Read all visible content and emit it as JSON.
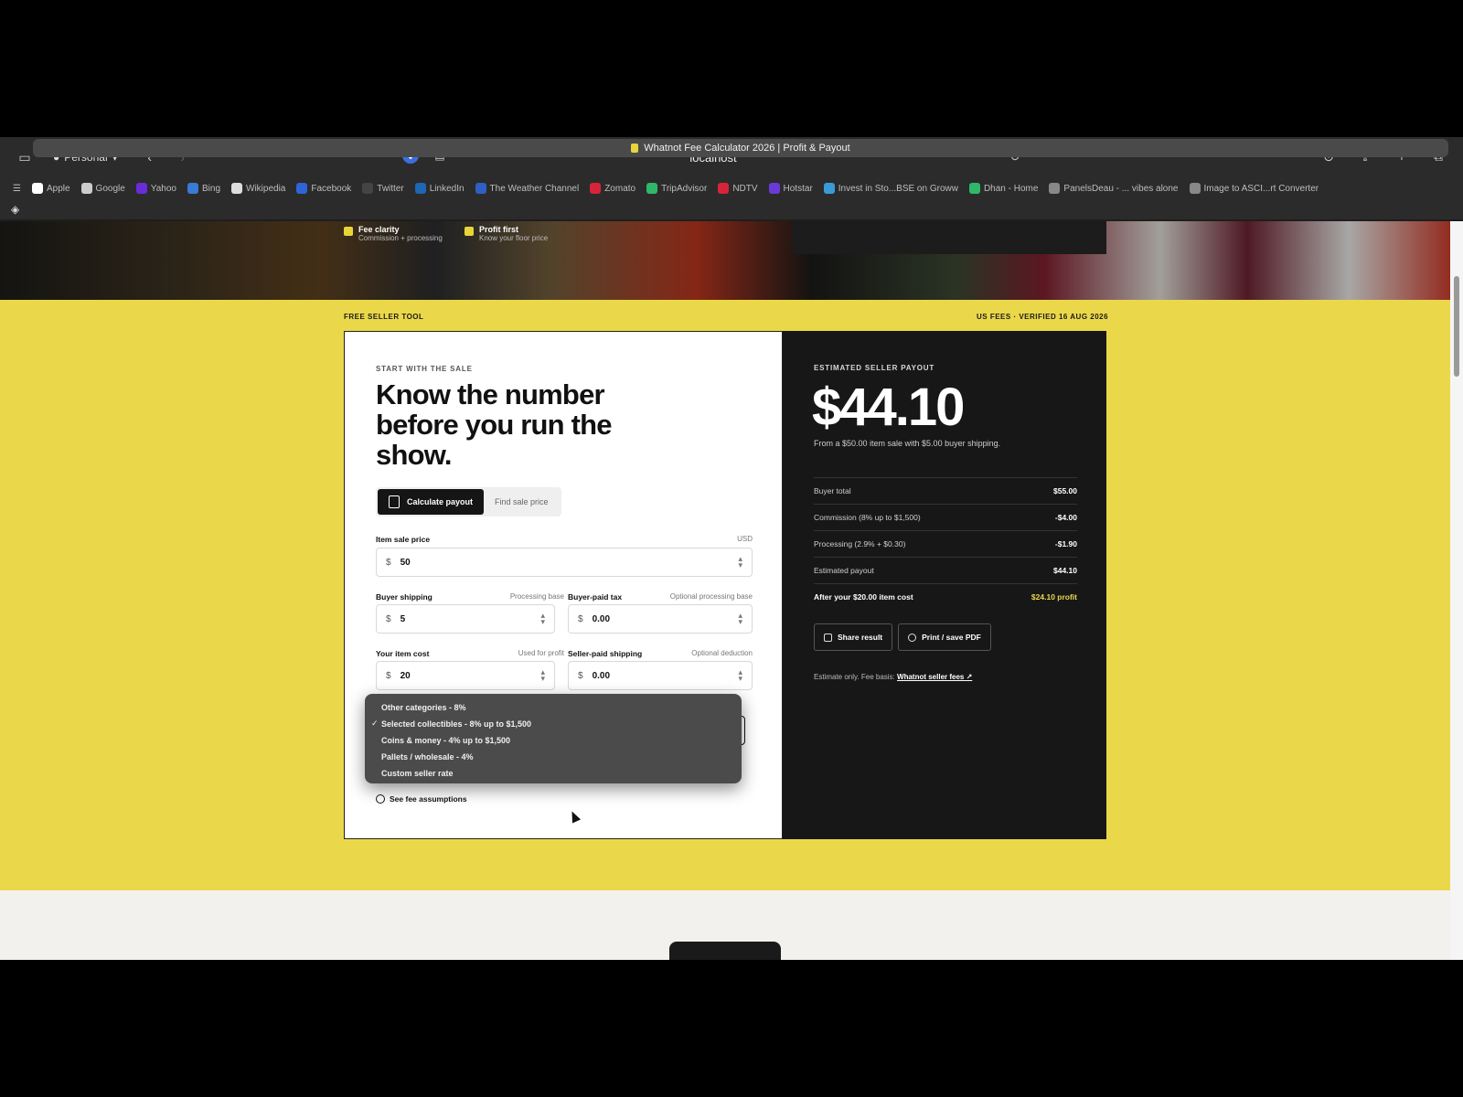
{
  "browser": {
    "profile": "Personal",
    "url": "localhost",
    "tab_title": "Whatnot Fee Calculator 2026 | Profit & Payout",
    "bookmarks": [
      {
        "label": "Apple",
        "color": "#ffffff"
      },
      {
        "label": "Google",
        "color": "#cccccc"
      },
      {
        "label": "Yahoo",
        "color": "#6a2bd8"
      },
      {
        "label": "Bing",
        "color": "#3a7bd5"
      },
      {
        "label": "Wikipedia",
        "color": "#dddddd"
      },
      {
        "label": "Facebook",
        "color": "#2d64d8"
      },
      {
        "label": "Twitter",
        "color": "#444444"
      },
      {
        "label": "LinkedIn",
        "color": "#1d66b4"
      },
      {
        "label": "The Weather Channel",
        "color": "#2f5fc4"
      },
      {
        "label": "Zomato",
        "color": "#d8243a"
      },
      {
        "label": "TripAdvisor",
        "color": "#2fb86a"
      },
      {
        "label": "NDTV",
        "color": "#d8243a"
      },
      {
        "label": "Hotstar",
        "color": "#6a3ad8"
      },
      {
        "label": "Invest in Sto...BSE on Groww",
        "color": "#3a9ad8"
      },
      {
        "label": "Dhan - Home",
        "color": "#2fb86a"
      },
      {
        "label": "PanelsDeau - ... vibes alone",
        "color": "#888888"
      },
      {
        "label": "Image to ASCI...rt Converter",
        "color": "#888888"
      }
    ]
  },
  "hero": {
    "badges": [
      {
        "title": "Fee clarity",
        "sub": "Commission + processing"
      },
      {
        "title": "Profit first",
        "sub": "Know your floor price"
      }
    ]
  },
  "section": {
    "eyebrow_left": "FREE SELLER TOOL",
    "eyebrow_right": "US FEES · VERIFIED 16 AUG 2026"
  },
  "calculator": {
    "kicker": "START WITH THE SALE",
    "headline": "Know the number before you run the show.",
    "mode_tabs": {
      "active": "Calculate payout",
      "inactive": "Find sale price"
    },
    "fields": {
      "item_price": {
        "label": "Item sale price",
        "hint": "USD",
        "currency": "$",
        "value": "50"
      },
      "buyer_shipping": {
        "label": "Buyer shipping",
        "hint": "Processing base",
        "currency": "$",
        "value": "5"
      },
      "buyer_tax": {
        "label": "Buyer-paid tax",
        "hint": "Optional processing base",
        "currency": "$",
        "value": "0.00"
      },
      "item_cost": {
        "label": "Your item cost",
        "hint": "Used for profit",
        "currency": "$",
        "value": "20"
      },
      "seller_shipping": {
        "label": "Seller-paid shipping",
        "hint": "Optional deduction",
        "currency": "$",
        "value": "0.00"
      }
    },
    "category_options": [
      {
        "label": "Other categories - 8%",
        "selected": false
      },
      {
        "label": "Selected collectibles - 8% up to $1,500",
        "selected": true
      },
      {
        "label": "Coins & money - 4% up to $1,500",
        "selected": false
      },
      {
        "label": "Pallets / wholesale - 4%",
        "selected": false
      },
      {
        "label": "Custom seller rate",
        "selected": false
      }
    ],
    "check_glyph": "✓",
    "assumptions_link": "See fee assumptions"
  },
  "result": {
    "kicker": "ESTIMATED SELLER PAYOUT",
    "amount": "$44.10",
    "sub": "From a $50.00 item sale with $5.00 buyer shipping.",
    "rows": [
      {
        "label": "Buyer total",
        "value": "$55.00"
      },
      {
        "label": "Commission (8% up to $1,500)",
        "value": "-$4.00"
      },
      {
        "label": "Processing (2.9% + $0.30)",
        "value": "-$1.90"
      },
      {
        "label": "Estimated payout",
        "value": "$44.10"
      },
      {
        "label": "After your $20.00 item cost",
        "value": "$24.10 profit"
      }
    ],
    "actions": {
      "share": "Share result",
      "print": "Print / save PDF"
    },
    "note_prefix": "Estimate only. Fee basis:",
    "note_link": "Whatnot seller fees ↗"
  },
  "colors": {
    "accent_yellow": "#ebd84a",
    "dark_panel": "#171717"
  }
}
